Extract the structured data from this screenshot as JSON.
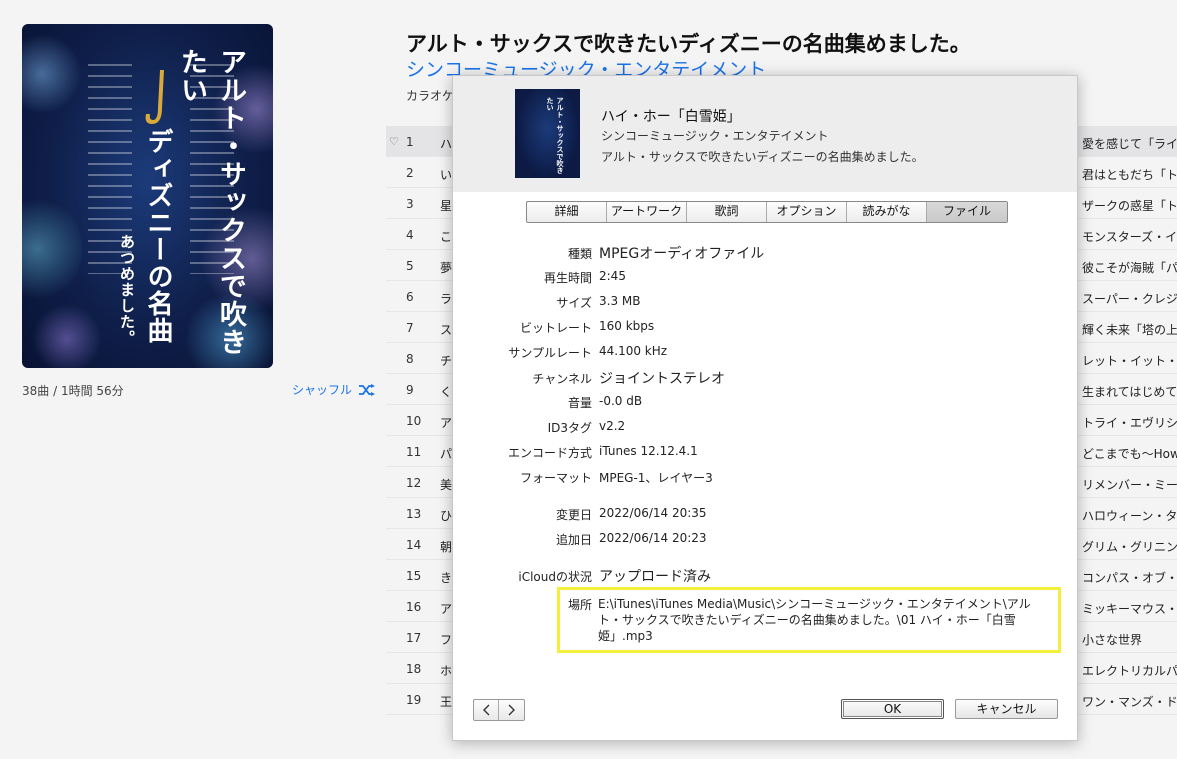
{
  "album": {
    "title": "アルト・サックスで吹きたいディズニーの名曲集めました。",
    "artist": "シンコーミュージック・エンタテイメント",
    "genre": "カラオケ・",
    "art_title_1": "アルト・サックスで吹きたい",
    "art_title_2": "ディズニーの名曲",
    "art_title_3": "あつめました。",
    "summary": "38曲 / 1時間 56分",
    "shuffle_label": "シャッフル"
  },
  "tracks": [
    {
      "num": "1",
      "head": "ハ",
      "right": "愛を感じて「ライオン"
    },
    {
      "num": "2",
      "head": "い",
      "right": "君はともだち「トイ・"
    },
    {
      "num": "3",
      "head": "星",
      "right": "ザークの惑星「トイ・"
    },
    {
      "num": "4",
      "head": "こ",
      "right": "モンスターズ・インク"
    },
    {
      "num": "5",
      "head": "夢",
      "right": "彼こそが海賊「パイ"
    },
    {
      "num": "6",
      "head": "ラ",
      "right": "スーパー・クレジット"
    },
    {
      "num": "7",
      "head": "ス",
      "right": "輝く未来「塔の上の"
    },
    {
      "num": "8",
      "head": "チ",
      "right": "レット・イット・ゴー「"
    },
    {
      "num": "9",
      "head": "く",
      "right": "生まれてはじめて「"
    },
    {
      "num": "10",
      "head": "ア",
      "right": "トライ・エヴリシング"
    },
    {
      "num": "11",
      "head": "パ",
      "right": "どこまでも～How F"
    },
    {
      "num": "12",
      "head": "美",
      "right": "リメンバー・ミー「リメ"
    },
    {
      "num": "13",
      "head": "ひ",
      "right": "ハロウィーン・タウン"
    },
    {
      "num": "14",
      "head": "朝",
      "right": "グリム・グリニング・"
    },
    {
      "num": "15",
      "head": "き",
      "right": "コンパス・オブ・ユア"
    },
    {
      "num": "16",
      "head": "ア",
      "right": "ミッキーマウス・マー"
    },
    {
      "num": "17",
      "head": "フ",
      "right": "小さな世界"
    },
    {
      "num": "18",
      "head": "ホ",
      "right": "エレクトリカルパレー"
    },
    {
      "num": "19",
      "head": "王",
      "right": "ワン・マンズ・ドリー"
    }
  ],
  "dialog": {
    "song": "ハイ・ホー「白雪姫」",
    "artist": "シンコーミュージック・エンタテイメント",
    "album": "アルト・サックスで吹きたいディズニーの名曲集めました。",
    "tabs": [
      {
        "label": "詳細"
      },
      {
        "label": "アートワーク"
      },
      {
        "label": "歌詞"
      },
      {
        "label": "オプション"
      },
      {
        "label": "読みがな"
      },
      {
        "label": "ファイル"
      }
    ],
    "info": {
      "kind_label": "種類",
      "kind": "MPEGオーディオファイル",
      "time_label": "再生時間",
      "time": "2:45",
      "size_label": "サイズ",
      "size": "3.3 MB",
      "bitrate_label": "ビットレート",
      "bitrate": "160 kbps",
      "samplerate_label": "サンプルレート",
      "samplerate": "44.100 kHz",
      "channel_label": "チャンネル",
      "channel": "ジョイントステレオ",
      "volume_label": "音量",
      "volume": "-0.0 dB",
      "id3_label": "ID3タグ",
      "id3": "v2.2",
      "encoder_label": "エンコード方式",
      "encoder": "iTunes 12.12.4.1",
      "format_label": "フォーマット",
      "format": "MPEG-1、レイヤー3",
      "modified_label": "変更日",
      "modified": "2022/06/14 20:35",
      "added_label": "追加日",
      "added": "2022/06/14 20:23",
      "icloud_label": "iCloudの状況",
      "icloud": "アップロード済み",
      "location_label": "場所",
      "location": "E:\\iTunes\\iTunes Media\\Music\\シンコーミュージック・エンタテイメント\\アルト・サックスで吹きたいディズニーの名曲集めました。\\01 ハイ・ホー「白雪姫」.mp3"
    },
    "ok_label": "OK",
    "cancel_label": "キャンセル"
  },
  "colors": {
    "accent": "#1a73e8",
    "highlight": "#f3ef3a"
  }
}
